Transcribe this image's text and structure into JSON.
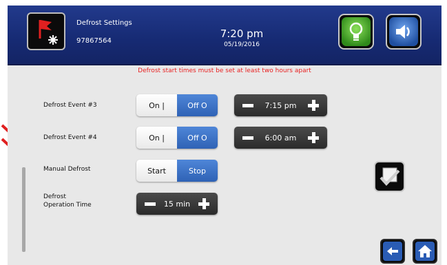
{
  "header": {
    "title": "Defrost Settings",
    "id": "97867564",
    "time": "7:20 pm",
    "date": "05/19/2016",
    "icons": {
      "main": "defrost-flag-icon",
      "light": "lightbulb-icon",
      "sound": "speaker-icon"
    }
  },
  "warning": "Defrost start times must be set at least two hours apart",
  "events": [
    {
      "label": "Defrost Event #3",
      "on_label": "On |",
      "off_label": "Off O",
      "state": "off",
      "time": "7:15 pm"
    },
    {
      "label": "Defrost Event #4",
      "on_label": "On |",
      "off_label": "Off O",
      "state": "off",
      "time": "6:00 am"
    }
  ],
  "manual": {
    "label": "Manual Defrost",
    "start_label": "Start",
    "stop_label": "Stop",
    "state": "stop"
  },
  "operation": {
    "label_line1": "Defrost",
    "label_line2": "Operation Time",
    "value": "15 min"
  },
  "actions": {
    "confirm_icon": "checkmark-icon",
    "back_icon": "back-arrow-icon",
    "home_icon": "home-icon"
  },
  "colors": {
    "header": "#1c2f7a",
    "accent_blue": "#3b6fc4",
    "warning": "#e82020",
    "light_button": "#5bb82e",
    "sound_button": "#2d5fb0"
  }
}
